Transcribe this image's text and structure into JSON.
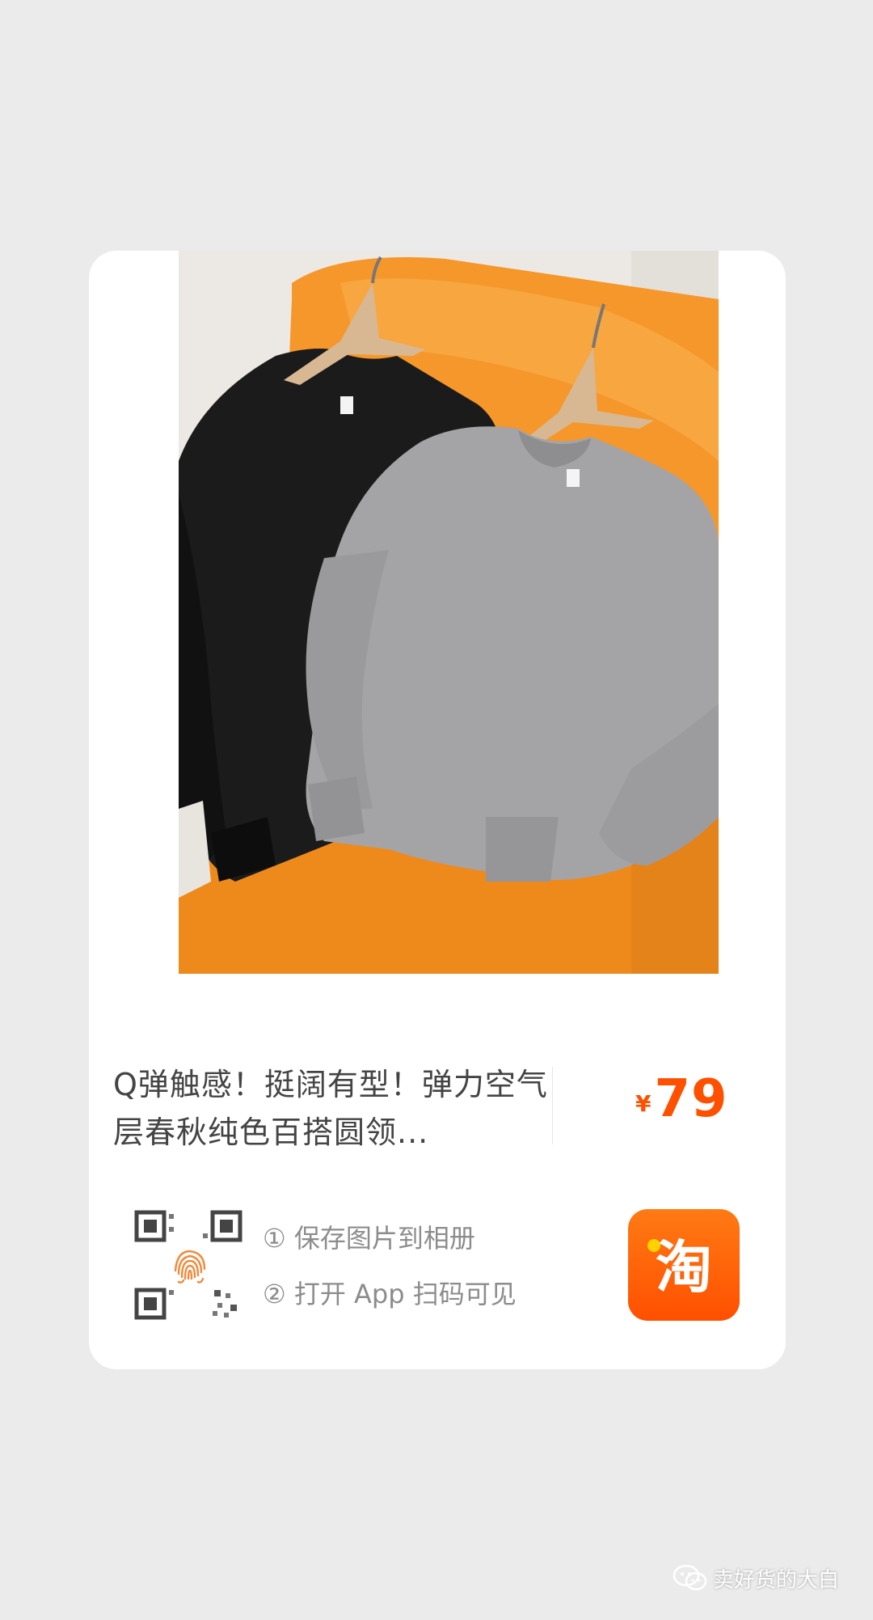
{
  "product": {
    "image_alt": "黑色与灰色圆领卫衣挂在橙色沙发上",
    "title": "Q弹触感！挺阔有型！弹力空气层春秋纯色百搭圆领...",
    "price": {
      "currency": "¥",
      "amount": "79"
    }
  },
  "share": {
    "step1": "① 保存图片到相册",
    "step2": "② 打开 App 扫码可见",
    "app_icon": "taobao-logo",
    "app_glyph": "淘"
  },
  "watermark": {
    "text": "卖好货的大白",
    "icon": "wechat-icon"
  },
  "colors": {
    "background": "#ebebeb",
    "card": "#ffffff",
    "price": "#ff5000",
    "taobao": "#ff5000",
    "sofa": "#f59a2d"
  }
}
